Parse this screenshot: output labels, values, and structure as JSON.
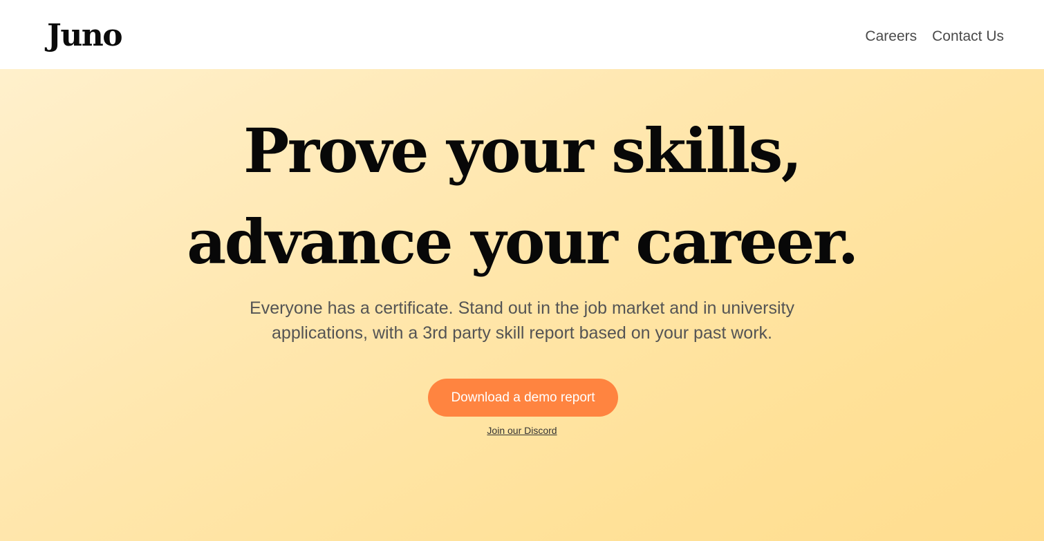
{
  "header": {
    "logo": "Juno",
    "nav": [
      {
        "label": "Careers"
      },
      {
        "label": "Contact Us"
      }
    ]
  },
  "hero": {
    "title_line_1": "Prove your skills,",
    "title_line_2": "advance your career.",
    "subtitle": "Everyone has a certificate. Stand out in the job market and in university applications, with a 3rd party skill report based on your past work.",
    "cta_label": "Download a demo report",
    "secondary_link": "Join our Discord"
  },
  "colors": {
    "cta_background": "#ff8440",
    "hero_gradient_start": "#fff0cc",
    "hero_gradient_end": "#ffdd8f",
    "text_dark": "#080808",
    "text_muted": "#545454"
  }
}
